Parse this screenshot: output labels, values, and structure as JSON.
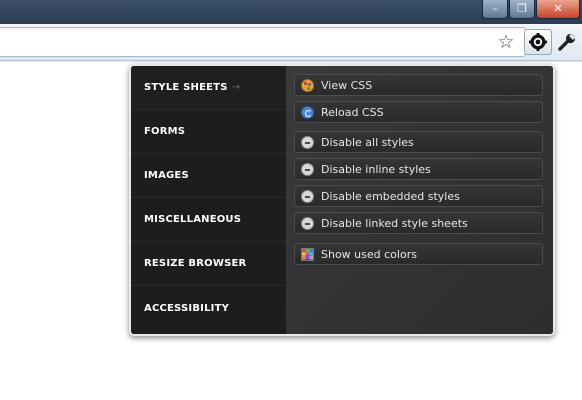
{
  "window": {
    "minimize_glyph": "–",
    "maximize_glyph": "❐",
    "close_glyph": "✕"
  },
  "toolbar": {
    "star_glyph": "☆",
    "icons": [
      "bookmark-star-icon",
      "gear-icon",
      "wrench-icon"
    ]
  },
  "menu": {
    "categories": [
      {
        "label": "STYLE SHEETS",
        "active": true
      },
      {
        "label": "FORMS"
      },
      {
        "label": "IMAGES"
      },
      {
        "label": "MISCELLANEOUS"
      },
      {
        "label": "RESIZE BROWSER"
      },
      {
        "label": "ACCESSIBILITY"
      }
    ],
    "active_arrow": "→",
    "actions": [
      {
        "label": "View CSS",
        "icon": "palette-icon"
      },
      {
        "label": "Reload CSS",
        "icon": "reload-icon"
      },
      {
        "label": "Disable all styles",
        "icon": "minus-circle-icon"
      },
      {
        "label": "Disable inline styles",
        "icon": "minus-circle-icon"
      },
      {
        "label": "Disable embedded styles",
        "icon": "minus-circle-icon"
      },
      {
        "label": "Disable linked style sheets",
        "icon": "minus-circle-icon"
      },
      {
        "label": "Show used colors",
        "icon": "color-grid-icon"
      }
    ]
  }
}
